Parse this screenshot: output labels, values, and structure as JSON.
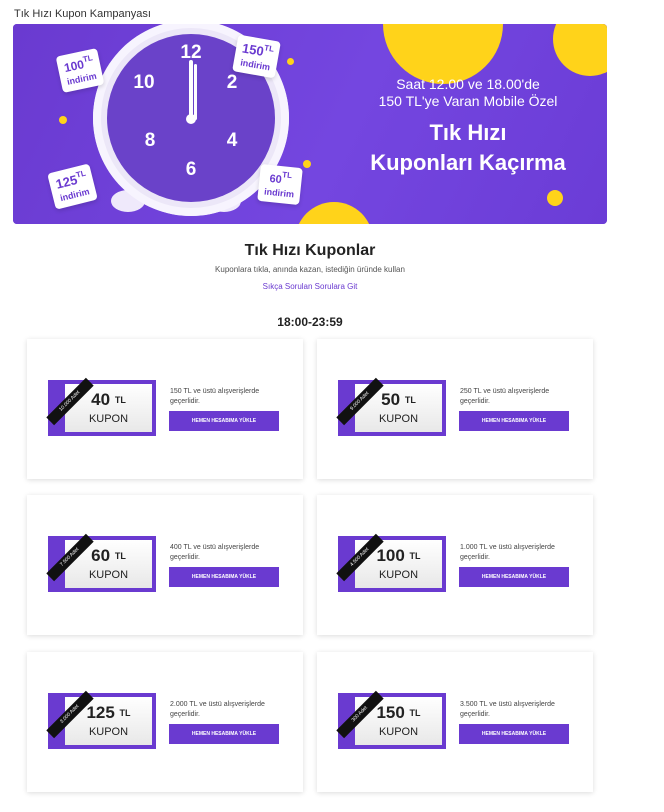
{
  "page": {
    "title": "Tık Hızı Kupon Kampanyası"
  },
  "banner": {
    "subtitle_line1": "Saat 12.00 ve 18.00'de",
    "subtitle_line2": "150 TL'ye Varan Mobile Özel",
    "title_line1": "Tık Hızı",
    "title_line2": "Kuponları Kaçırma",
    "clock_numbers": [
      "12",
      "2",
      "4",
      "6",
      "8",
      "10"
    ],
    "tags": [
      {
        "amount": "100",
        "unit": "TL",
        "label": "indirim"
      },
      {
        "amount": "150",
        "unit": "TL",
        "label": "indirim"
      },
      {
        "amount": "125",
        "unit": "TL",
        "label": "indirim"
      },
      {
        "amount": "60",
        "unit": "TL",
        "label": "indirim"
      }
    ]
  },
  "section": {
    "title": "Tık Hızı Kuponlar",
    "subtitle": "Kuponlara tıkla, anında kazan, istediğin üründe kullan",
    "faq_link": "Sıkça Sorulan Sorulara Git",
    "time_range": "18:00-23:59"
  },
  "coupons": [
    {
      "amount": "40",
      "unit": "TL",
      "label": "KUPON",
      "ribbon": "10.000 Adet",
      "desc": "150 TL ve üstü alışverişlerde geçerlidir.",
      "button": "HEMEN HESABIMA YÜKLE"
    },
    {
      "amount": "50",
      "unit": "TL",
      "label": "KUPON",
      "ribbon": "9.000 Adet",
      "desc": "250 TL ve üstü alışverişlerde geçerlidir.",
      "button": "HEMEN HESABIMA YÜKLE"
    },
    {
      "amount": "60",
      "unit": "TL",
      "label": "KUPON",
      "ribbon": "7.500 Adet",
      "desc": "400 TL ve üstü alışverişlerde geçerlidir.",
      "button": "HEMEN HESABIMA YÜKLE"
    },
    {
      "amount": "100",
      "unit": "TL",
      "label": "KUPON",
      "ribbon": "4.500 Adet",
      "desc": "1.000 TL ve üstü alışverişlerde geçerlidir.",
      "button": "HEMEN HESABIMA YÜKLE"
    },
    {
      "amount": "125",
      "unit": "TL",
      "label": "KUPON",
      "ribbon": "3.000 Adet",
      "desc": "2.000 TL ve üstü alışverişlerde geçerlidir.",
      "button": "HEMEN HESABIMA YÜKLE"
    },
    {
      "amount": "150",
      "unit": "TL",
      "label": "KUPON",
      "ribbon": "300 Adet",
      "desc": "3.500 TL ve üstü alışverişlerde geçerlidir.",
      "button": "HEMEN HESABIMA YÜKLE"
    }
  ],
  "colors": {
    "brand_purple": "#6a3ad0",
    "accent_yellow": "#ffd31a"
  }
}
